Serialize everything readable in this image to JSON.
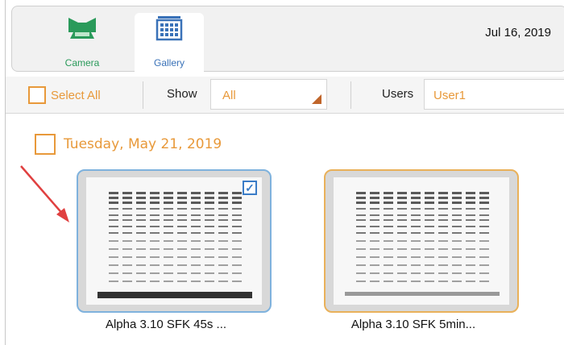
{
  "header": {
    "nav": [
      {
        "label": "Camera",
        "icon": "camera-icon",
        "color": "#2a9a5a"
      },
      {
        "label": "Gallery",
        "icon": "gallery-icon",
        "color": "#3a72b8",
        "active": true
      }
    ],
    "date": "Jul 16, 2019"
  },
  "toolbar": {
    "select_all": "Select All",
    "show_label": "Show",
    "show_value": "All",
    "users_label": "Users",
    "users_value": "User1"
  },
  "gallery": {
    "group_date": "Tuesday, May 21, 2019",
    "items": [
      {
        "title": "Alpha 3.10 SFK 45s ...",
        "selected": true,
        "border_color": "#7fb2dd"
      },
      {
        "title": "Alpha 3.10 SFK 5min...",
        "selected": false,
        "border_color": "#e9b15a"
      }
    ]
  },
  "colors": {
    "accent": "#e8993a",
    "annotation_arrow": "#e04040"
  }
}
